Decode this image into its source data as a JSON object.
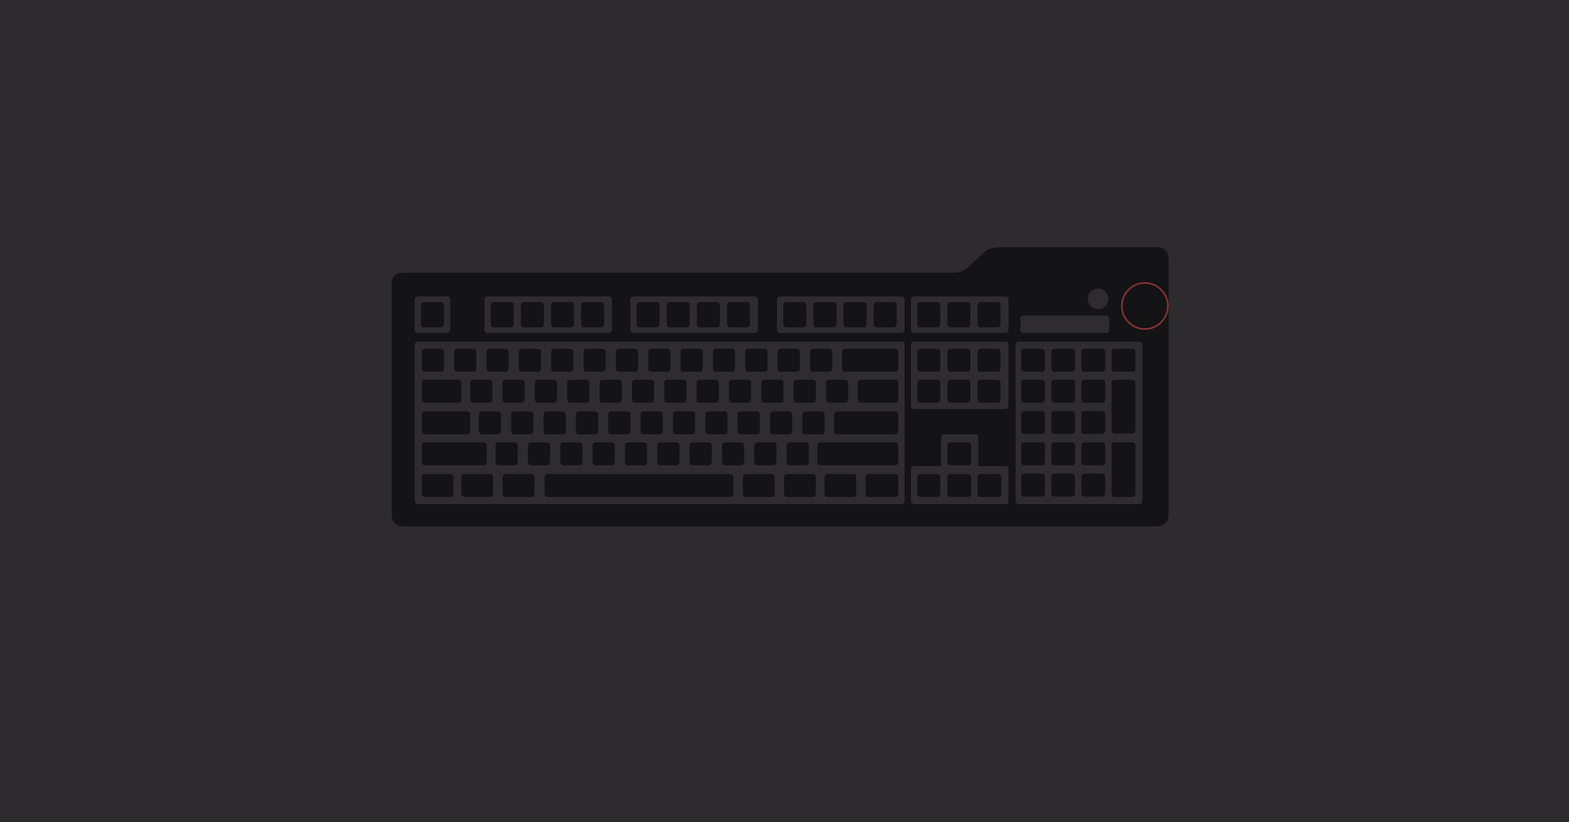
{
  "colors": {
    "background": "#2d2b2e",
    "keyboard_body": "#141316",
    "section_outline": "#2e2c30",
    "key_fill": "#141316",
    "knob_ring": "#8a3434",
    "knob_fill": "#141316"
  },
  "keyboard": {
    "sections": [
      "escape",
      "function-group-1",
      "function-group-2",
      "function-group-3",
      "system-keys",
      "main-alphanumeric",
      "navigation-cluster",
      "arrow-cluster",
      "numeric-keypad"
    ],
    "controls": [
      "small-button-icon",
      "round-button-icon",
      "media-bar-icon",
      "volume-knob-icon"
    ]
  }
}
